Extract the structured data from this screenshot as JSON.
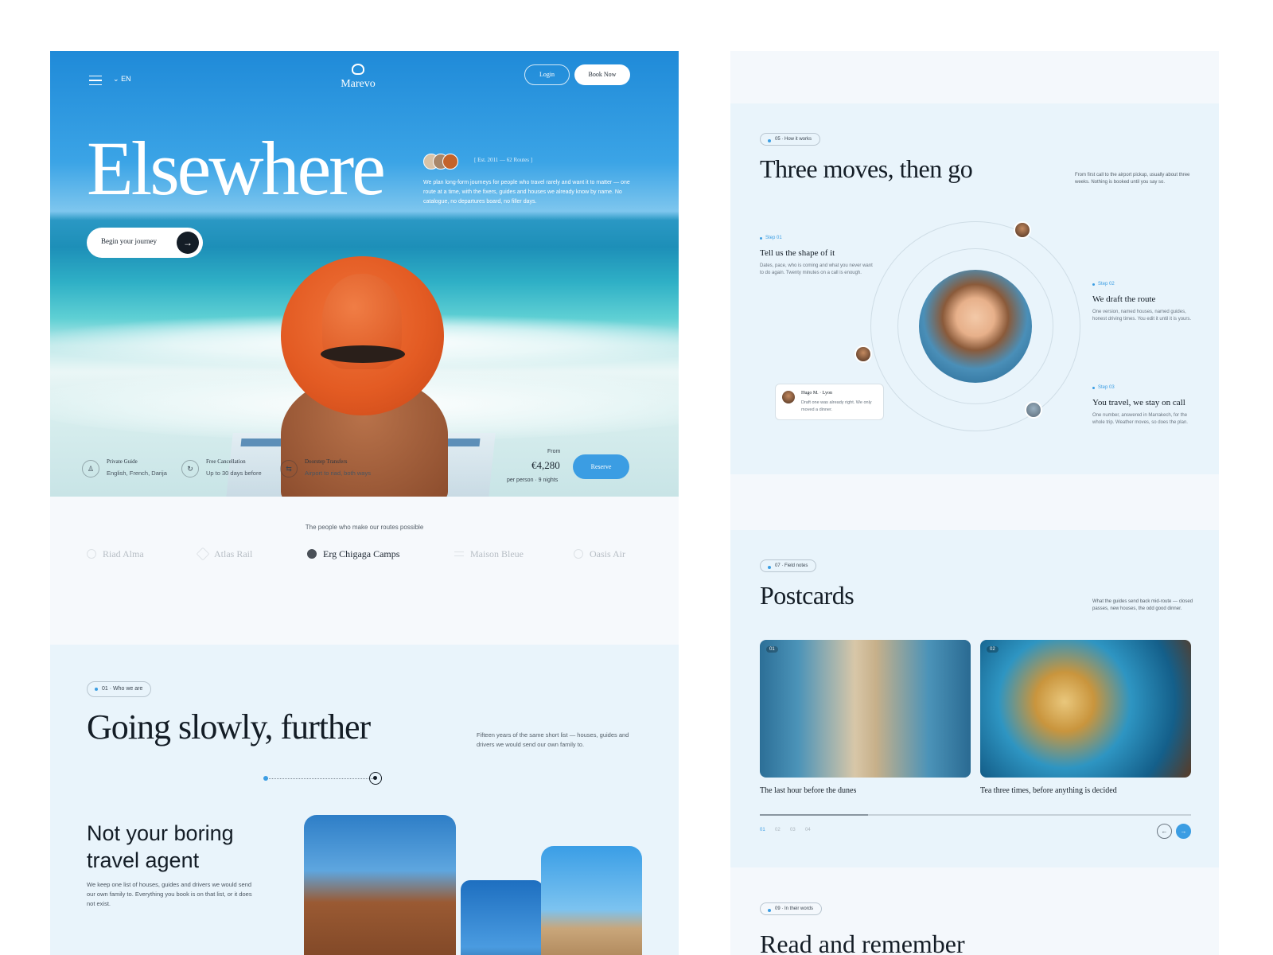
{
  "hero": {
    "lang": "EN",
    "logo": "Marevo",
    "login": "Login",
    "book_now": "Book Now",
    "title": "Elsewhere",
    "est": "[ Est. 2011 — 62 Routes ]",
    "description": "We plan long-form journeys for people who travel rarely and want it to matter — one route at a time, with the fixers, guides and houses we already know by name. No catalogue, no departures board, no filler days.",
    "cta": "Begin your journey",
    "swatch_colors": [
      "#d8c3a8",
      "#a8876a",
      "#c4632a"
    ],
    "features": [
      {
        "icon": "guide-icon",
        "glyph": "♙",
        "title": "Private Guide",
        "sub": "English, French, Darija"
      },
      {
        "icon": "refresh-icon",
        "glyph": "↻",
        "title": "Free Cancellation",
        "sub": "Up to 30 days before"
      },
      {
        "icon": "transfer-icon",
        "glyph": "⇆",
        "title": "Doorstep Transfers",
        "sub": "Airport to riad, both ways"
      }
    ],
    "from": "From",
    "price": "€4,280",
    "per": "per person · 9 nights",
    "reserve": "Reserve"
  },
  "partners": {
    "label": "The people who make our routes possible",
    "items": [
      "Riad Alma",
      "Atlas Rail",
      "Erg Chigaga Camps",
      "Maison Bleue",
      "Oasis Air"
    ],
    "active_index": 2
  },
  "about": {
    "pill": "01 · Who we are",
    "title": "Going slowly, further",
    "side": "Fifteen years of the same short list — houses, guides and drivers we would send our own family to.",
    "subtitle": "Not your boring travel agent",
    "text": "We keep one list of houses, guides and drivers we would send our own family to. Everything you book is on that list, or it does not exist."
  },
  "how": {
    "pill": "05 · How it works",
    "title": "Three moves, then go",
    "side": "From first call to the airport pickup, usually about three weeks. Nothing is booked until you say so.",
    "steps": [
      {
        "label": "Step 01",
        "title": "Tell us the shape of it",
        "text": "Dates, pace, who is coming and what you never want to do again. Twenty minutes on a call is enough."
      },
      {
        "label": "Step 02",
        "title": "We draft the route",
        "text": "One version, named houses, named guides, honest driving times. You edit it until it is yours."
      },
      {
        "label": "Step 03",
        "title": "You travel, we stay on call",
        "text": "One number, answered in Marrakech, for the whole trip. Weather moves, so does the plan."
      }
    ],
    "quote": {
      "name": "Hugo M. · Lyon",
      "text": "Draft one was already right. We only moved a dinner."
    }
  },
  "postcards": {
    "pill": "07 · Field notes",
    "title": "Postcards",
    "side": "What the guides send back mid-route — closed passes, new houses, the odd good dinner.",
    "cards": [
      {
        "num": "01",
        "caption": "The last hour before the dunes"
      },
      {
        "num": "02",
        "caption": "Tea three times, before anything is decided"
      }
    ],
    "pages": [
      "01",
      "02",
      "03",
      "04"
    ],
    "current_page": 1,
    "progress_fraction": 0.25,
    "prev": "←",
    "next": "→"
  },
  "words": {
    "pill": "09 · In their words",
    "title": "Read and remember"
  },
  "colors": {
    "accent": "#3b9de3",
    "ink": "#141d26",
    "section_bg": "#e9f4fb"
  }
}
